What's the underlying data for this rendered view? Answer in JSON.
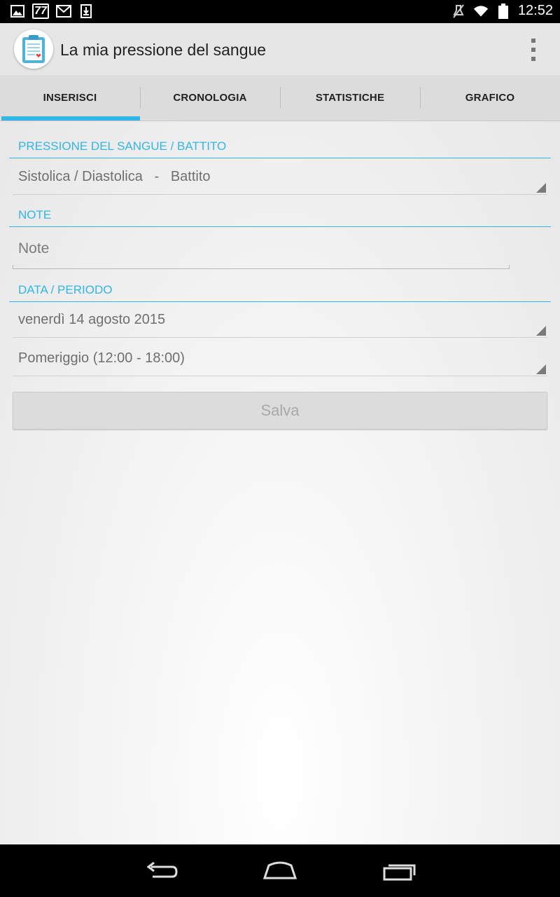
{
  "status_bar": {
    "notification_icons": [
      "image-icon",
      "calendar-77-icon",
      "gmail-icon",
      "download-icon"
    ],
    "calendar_badge": "77",
    "system_icons": [
      "mute-icon",
      "wifi-icon",
      "battery-icon"
    ],
    "time": "12:52"
  },
  "action_bar": {
    "app_icon": "clipboard-heart-icon",
    "title": "La mia pressione del sangue",
    "overflow_icon": "overflow-menu-icon"
  },
  "tabs": [
    {
      "label": "INSERISCI",
      "active": true
    },
    {
      "label": "CRONOLOGIA",
      "active": false
    },
    {
      "label": "STATISTICHE",
      "active": false
    },
    {
      "label": "GRAFICO",
      "active": false
    }
  ],
  "form": {
    "section_pressure": "PRESSIONE DEL SANGUE / BATTITO",
    "pressure_spinner": "Sistolica / Diastolica   -   Battito",
    "section_note": "NOTE",
    "note_placeholder": "Note",
    "note_value": "",
    "section_date": "DATA / PERIODO",
    "date_spinner": "venerdì 14 agosto 2015",
    "period_spinner": "Pomeriggio (12:00 - 18:00)",
    "save_label": "Salva"
  },
  "colors": {
    "accent": "#33b5e5",
    "background": "#f2f2f2",
    "tab_bar": "#dcdcdc"
  },
  "nav_bar": {
    "buttons": [
      "back-icon",
      "home-icon",
      "recents-icon"
    ]
  }
}
